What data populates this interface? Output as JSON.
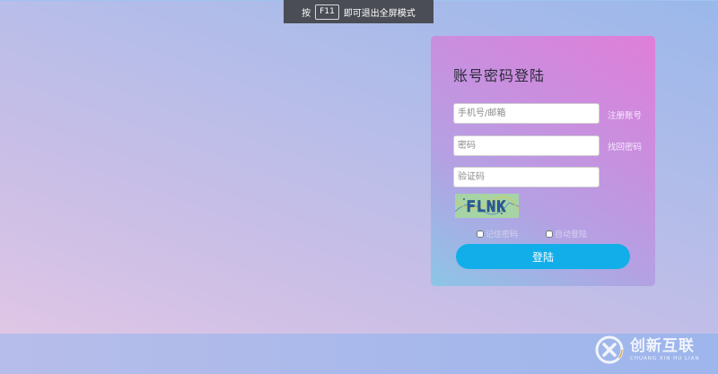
{
  "fullscreen_hint": {
    "prefix": "按",
    "key": "F11",
    "suffix": "即可退出全屏模式"
  },
  "login": {
    "title": "账号密码登陆",
    "username_placeholder": "手机号/邮箱",
    "register_link": "注册账号",
    "password_placeholder": "密码",
    "forgot_link": "找回密码",
    "captcha_placeholder": "验证码",
    "captcha_image_text": "FLNK",
    "remember_label": "记住密码",
    "auto_login_label": "自动登陆",
    "submit_label": "登陆",
    "button_color": "#12aee9"
  },
  "watermark": {
    "name": "创新互联",
    "sub": "CHUANG XIN HU LIAN"
  }
}
